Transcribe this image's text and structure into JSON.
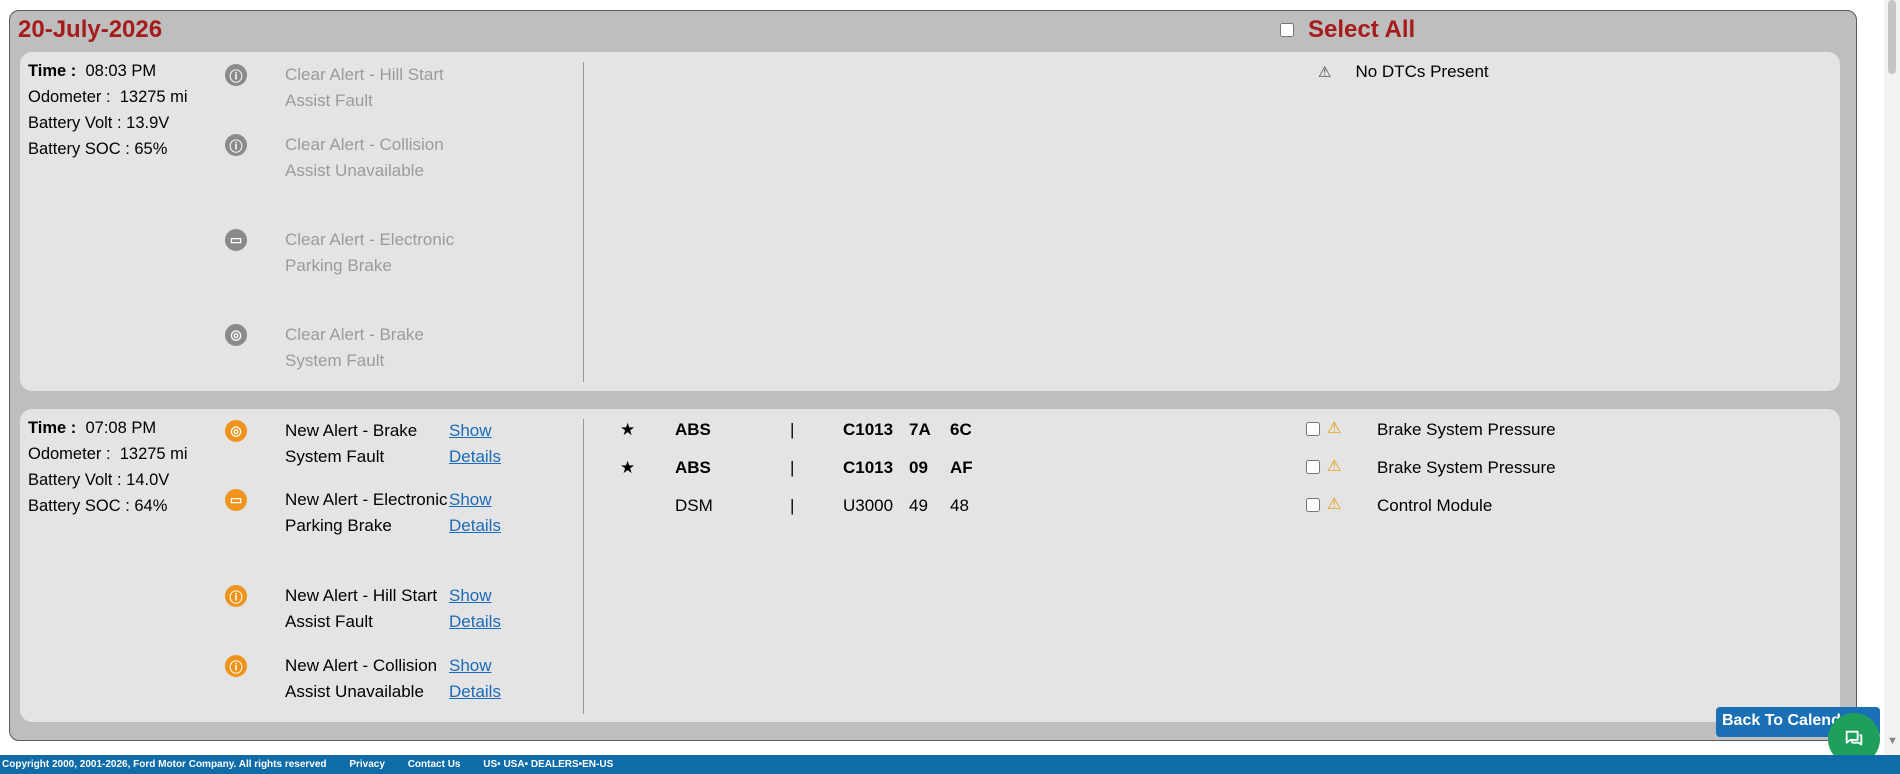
{
  "header": {
    "date": "20-July-2026",
    "select_all_label": "Select All"
  },
  "cards": [
    {
      "time_label": "Time :",
      "time": "08:03 PM",
      "odometer_label": "Odometer :",
      "odometer": "13275 mi",
      "battery_volt_label": "Battery Volt :",
      "battery_volt": "13.9V",
      "battery_soc_label": "Battery SOC :",
      "battery_soc": "65%",
      "alerts": [
        {
          "icon": "info-icon",
          "text": "Clear Alert - Hill Start Assist Fault"
        },
        {
          "icon": "info-icon",
          "text": "Clear Alert - Collision Assist Unavailable"
        },
        {
          "icon": "parking-brake-icon",
          "text": "Clear Alert - Electronic Parking Brake"
        },
        {
          "icon": "brake-icon",
          "text": "Clear Alert - Brake System Fault"
        }
      ],
      "no_dtc_text": "No DTCs Present"
    },
    {
      "time_label": "Time :",
      "time": "07:08 PM",
      "odometer_label": "Odometer :",
      "odometer": "13275 mi",
      "battery_volt_label": "Battery Volt :",
      "battery_volt": "14.0V",
      "battery_soc_label": "Battery SOC :",
      "battery_soc": "64%",
      "alerts": [
        {
          "icon": "brake-icon",
          "text": "New Alert - Brake System Fault",
          "link": "Show Details"
        },
        {
          "icon": "parking-brake-icon",
          "text": "New Alert - Electronic Parking Brake",
          "link": "Show Details"
        },
        {
          "icon": "info-icon",
          "text": "New Alert - Hill Start Assist Fault",
          "link": "Show Details"
        },
        {
          "icon": "info-icon",
          "text": "New Alert - Collision Assist Unavailable",
          "link": "Show Details"
        }
      ],
      "dtcs": [
        {
          "star": "★",
          "module": "ABS",
          "sep": "|",
          "code": "C1013",
          "c2": "7A",
          "c3": "6C",
          "description": "Brake System Pressure"
        },
        {
          "star": "★",
          "module": "ABS",
          "sep": "|",
          "code": "C1013",
          "c2": "09",
          "c3": "AF",
          "description": "Brake System Pressure"
        },
        {
          "star": "",
          "module": "DSM",
          "sep": "|",
          "code": "U3000",
          "c2": "49",
          "c3": "48",
          "description": "Control Module"
        }
      ]
    }
  ],
  "back_button": "Back To Calendar",
  "footer": {
    "copyright": "Copyright 2000, 2001-2026, Ford Motor Company. All rights reserved",
    "privacy": "Privacy",
    "contact": "Contact Us",
    "locale": "US• USA• DEALERS•EN-US"
  },
  "colors": {
    "header_red": "#a61c1c",
    "link_blue": "#1a6bb8",
    "alert_orange": "#f0931a",
    "footer_blue": "#0f6ca8",
    "chat_green": "#1fa05a"
  }
}
